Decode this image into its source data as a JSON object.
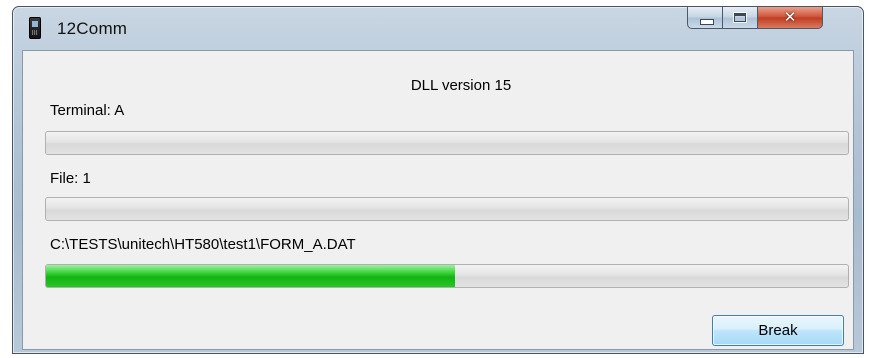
{
  "window": {
    "title": "12Comm",
    "icon": "handheld-terminal-icon",
    "caption_buttons": {
      "minimize_icon": "minimize-icon",
      "maximize_icon": "maximize-icon",
      "close_label": "✕"
    }
  },
  "dialog": {
    "dll_version": "DLL version 15",
    "terminal_label": "Terminal: A",
    "terminal_progress": 0,
    "file_label": "File: 1",
    "file_progress": 0,
    "current_file_path": "C:\\TESTS\\unitech\\HT580\\test1\\FORM_A.DAT",
    "file_transfer_progress": 0.51,
    "break_button_label": "Break"
  },
  "colors": {
    "progress_fill": "#12b312",
    "close_button": "#c03c22",
    "dialog_background": "#f0f0f0"
  }
}
